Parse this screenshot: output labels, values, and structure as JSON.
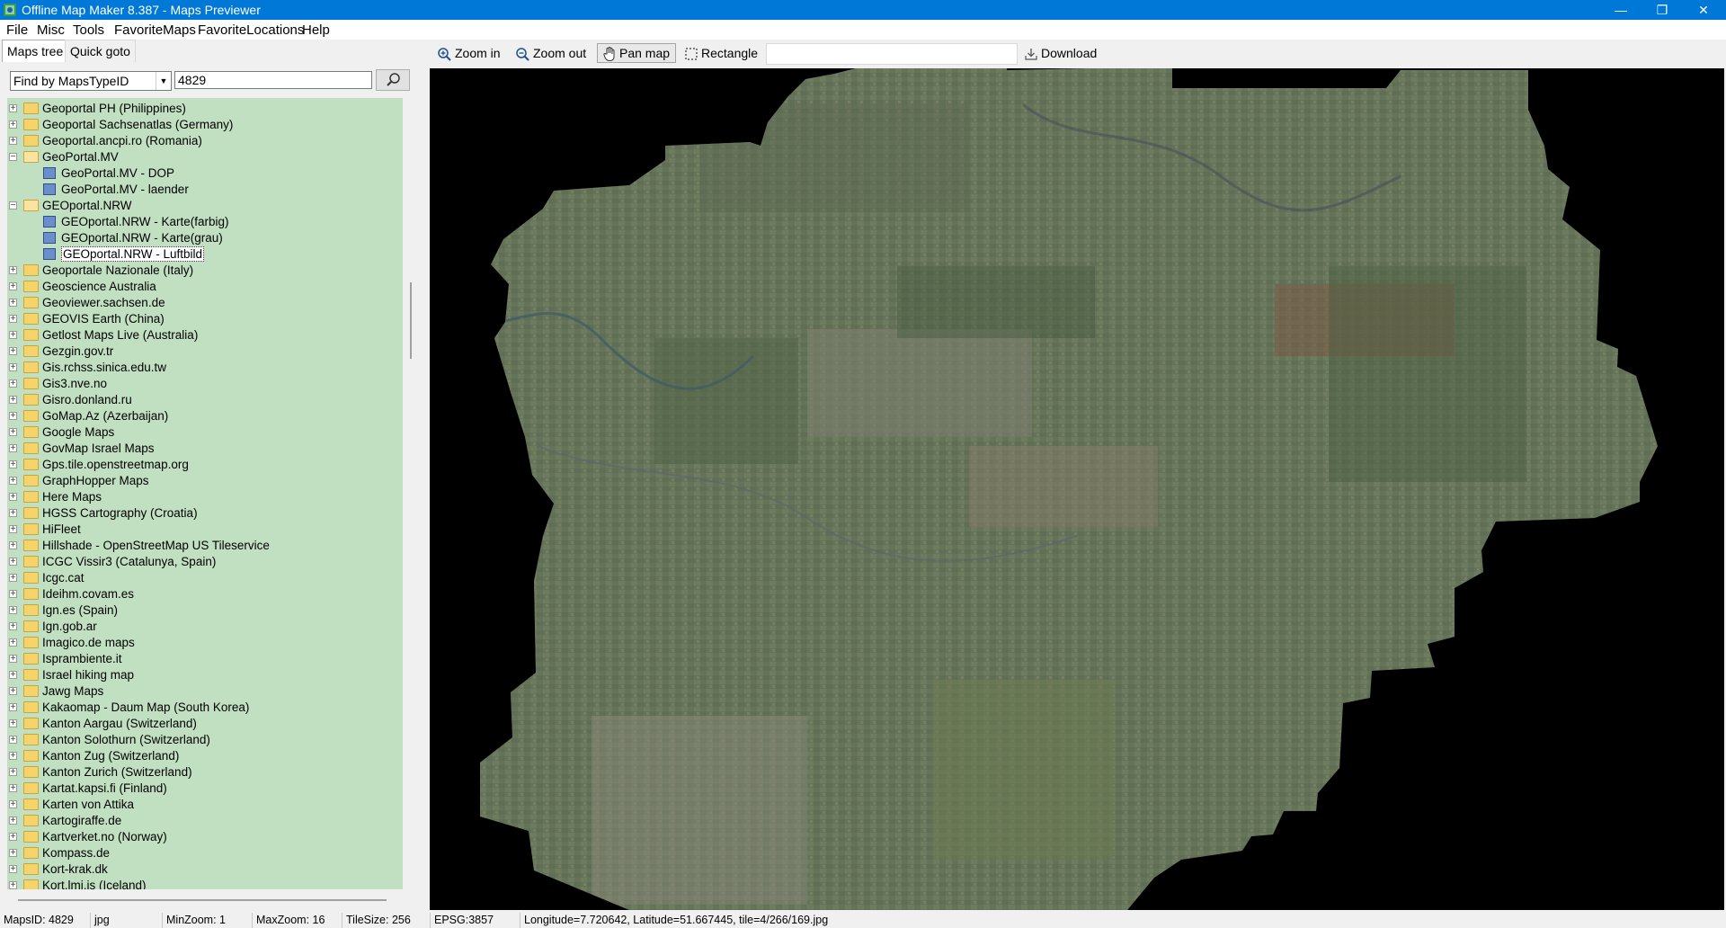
{
  "window": {
    "title": "Offline Map Maker 8.387 - Maps Previewer",
    "minimize": "—",
    "maximize": "❐",
    "close": "✕"
  },
  "menu": [
    "File",
    "Misc",
    "Tools",
    "FavoriteMaps",
    "FavoriteLocations",
    "Help"
  ],
  "tabs": [
    "Maps tree",
    "Quick goto"
  ],
  "find": {
    "mode": "Find by MapsTypeID",
    "query": "4829"
  },
  "tree": [
    {
      "label": "Geoportal PH (Philippines)",
      "kind": "folder"
    },
    {
      "label": "Geoportal Sachsenatlas (Germany)",
      "kind": "folder"
    },
    {
      "label": "Geoportal.ancpi.ro (Romania)",
      "kind": "folder"
    },
    {
      "label": "GeoPortal.MV",
      "kind": "folder-open"
    },
    {
      "label": "GeoPortal.MV - DOP",
      "kind": "map"
    },
    {
      "label": "GeoPortal.MV - laender",
      "kind": "map"
    },
    {
      "label": "GEOportal.NRW",
      "kind": "folder-open"
    },
    {
      "label": "GEOportal.NRW - Karte(farbig)",
      "kind": "map"
    },
    {
      "label": "GEOportal.NRW - Karte(grau)",
      "kind": "map"
    },
    {
      "label": "GEOportal.NRW - Luftbild",
      "kind": "map-selected"
    },
    {
      "label": "Geoportale Nazionale (Italy)",
      "kind": "folder"
    },
    {
      "label": "Geoscience Australia",
      "kind": "folder"
    },
    {
      "label": "Geoviewer.sachsen.de",
      "kind": "folder"
    },
    {
      "label": "GEOVIS Earth (China)",
      "kind": "folder"
    },
    {
      "label": "Getlost Maps Live (Australia)",
      "kind": "folder"
    },
    {
      "label": "Gezgin.gov.tr",
      "kind": "folder"
    },
    {
      "label": "Gis.rchss.sinica.edu.tw",
      "kind": "folder"
    },
    {
      "label": "Gis3.nve.no",
      "kind": "folder"
    },
    {
      "label": "Gisro.donland.ru",
      "kind": "folder"
    },
    {
      "label": "GoMap.Az (Azerbaijan)",
      "kind": "folder"
    },
    {
      "label": "Google Maps",
      "kind": "folder"
    },
    {
      "label": "GovMap Israel Maps",
      "kind": "folder"
    },
    {
      "label": "Gps.tile.openstreetmap.org",
      "kind": "folder"
    },
    {
      "label": "GraphHopper Maps",
      "kind": "folder"
    },
    {
      "label": "Here Maps",
      "kind": "folder"
    },
    {
      "label": "HGSS Cartography (Croatia)",
      "kind": "folder"
    },
    {
      "label": "HiFleet",
      "kind": "folder"
    },
    {
      "label": "Hillshade - OpenStreetMap US Tileservice",
      "kind": "folder"
    },
    {
      "label": "ICGC Vissir3 (Catalunya, Spain)",
      "kind": "folder"
    },
    {
      "label": "Icgc.cat",
      "kind": "folder"
    },
    {
      "label": "Ideihm.covam.es",
      "kind": "folder"
    },
    {
      "label": "Ign.es (Spain)",
      "kind": "folder"
    },
    {
      "label": "Ign.gob.ar",
      "kind": "folder"
    },
    {
      "label": "Imagico.de maps",
      "kind": "folder"
    },
    {
      "label": "Isprambiente.it",
      "kind": "folder"
    },
    {
      "label": "Israel hiking map",
      "kind": "folder"
    },
    {
      "label": "Jawg Maps",
      "kind": "folder"
    },
    {
      "label": "Kakaomap - Daum Map (South Korea)",
      "kind": "folder"
    },
    {
      "label": "Kanton Aargau (Switzerland)",
      "kind": "folder"
    },
    {
      "label": "Kanton Solothurn (Switzerland)",
      "kind": "folder"
    },
    {
      "label": "Kanton Zug (Switzerland)",
      "kind": "folder"
    },
    {
      "label": "Kanton Zurich (Switzerland)",
      "kind": "folder"
    },
    {
      "label": "Kartat.kapsi.fi (Finland)",
      "kind": "folder"
    },
    {
      "label": "Karten von Attika",
      "kind": "folder"
    },
    {
      "label": "Kartogiraffe.de",
      "kind": "folder"
    },
    {
      "label": "Kartverket.no (Norway)",
      "kind": "folder"
    },
    {
      "label": "Kompass.de",
      "kind": "folder"
    },
    {
      "label": "Kort-krak.dk",
      "kind": "folder"
    },
    {
      "label": "Kort.lmi.is (Iceland)",
      "kind": "folder"
    }
  ],
  "toolbar": {
    "zoom_in": "Zoom in",
    "zoom_out": "Zoom out",
    "pan_map": "Pan map",
    "rectangle": "Rectangle",
    "download": "Download"
  },
  "status": {
    "maps_id": "MapsID: 4829",
    "format": "jpg",
    "min_zoom": "MinZoom: 1",
    "max_zoom": "MaxZoom: 16",
    "tile_size": "TileSize: 256",
    "epsg": "EPSG:3857",
    "position": "Longitude=7.720642, Latitude=51.667445, tile=4/266/169.jpg"
  }
}
